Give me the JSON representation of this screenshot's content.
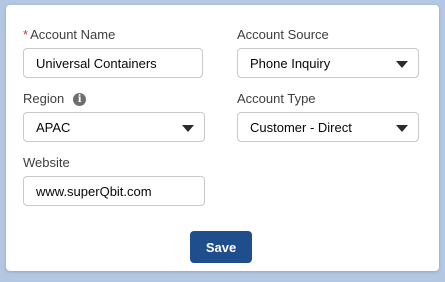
{
  "form": {
    "account_name": {
      "label": "Account Name",
      "required_marker": "*",
      "value": "Universal Containers"
    },
    "account_source": {
      "label": "Account Source",
      "value": "Phone Inquiry"
    },
    "region": {
      "label": "Region",
      "info_icon": "i",
      "value": "APAC"
    },
    "account_type": {
      "label": "Account Type",
      "value": "Customer - Direct"
    },
    "website": {
      "label": "Website",
      "value": "www.superQbit.com"
    }
  },
  "actions": {
    "save_label": "Save"
  },
  "colors": {
    "background": "#b3c7e3",
    "save_button": "#1f4e8c",
    "required": "#c23934"
  }
}
